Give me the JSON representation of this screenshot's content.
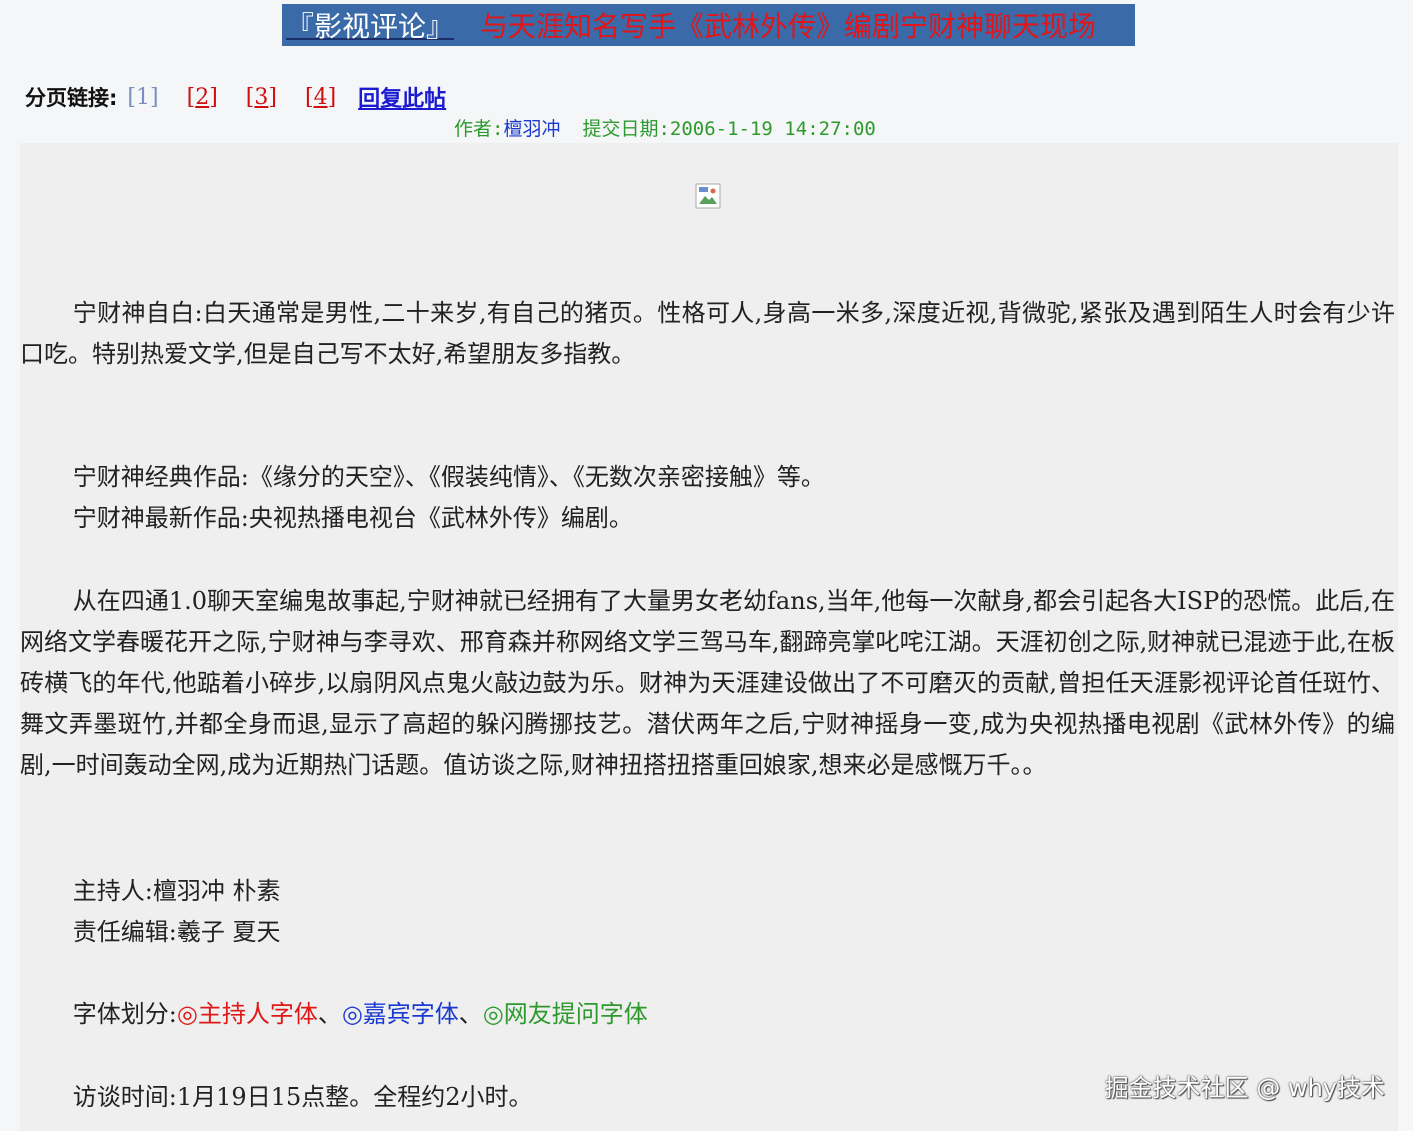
{
  "header": {
    "board": "『影视评论』",
    "title": "与天涯知名写手《武林外传》编剧宁财神聊天现场"
  },
  "paging": {
    "label": "分页链接:",
    "pages": [
      "1",
      "2",
      "3",
      "4"
    ],
    "current": "1",
    "reply": "回复此帖"
  },
  "meta": {
    "author_label": "作者:",
    "author": "檀羽冲",
    "date_label": "提交日期:",
    "date": "2006-1-19 14:27:00"
  },
  "content": {
    "intro": "宁财神自白:白天通常是男性,二十来岁,有自己的猪页。性格可人,身高一米多,深度近视,背微驼,紧张及遇到陌生人时会有少许口吃。特别热爱文学,但是自己写不太好,希望朋友多指教。",
    "classic": "宁财神经典作品:《缘分的天空》、《假装纯情》、《无数次亲密接触》等。",
    "latest": "宁财神最新作品:央视热播电视台《武林外传》编剧。",
    "story": "从在四通1.0聊天室编鬼故事起,宁财神就已经拥有了大量男女老幼fans,当年,他每一次献身,都会引起各大ISP的恐慌。此后,在网络文学春暖花开之际,宁财神与李寻欢、邢育森并称网络文学三驾马车,翻蹄亮掌叱咤江湖。天涯初创之际,财神就已混迹于此,在板砖横飞的年代,他踮着小碎步,以扇阴风点鬼火敲边鼓为乐。财神为天涯建设做出了不可磨灭的贡献,曾担任天涯影视评论首任斑竹、舞文弄墨斑竹,并都全身而退,显示了高超的躲闪腾挪技艺。潜伏两年之后,宁财神摇身一变,成为央视热播电视剧《武林外传》的编剧,一时间轰动全网,成为近期热门话题。值访谈之际,财神扭搭扭搭重回娘家,想来必是感慨万千。。",
    "host": "主持人:檀羽冲 朴素",
    "editor": "责任编辑:羲子 夏天",
    "font_label": "字体划分:",
    "font_host": "◎主持人字体",
    "font_guest": "◎嘉宾字体",
    "font_user": "◎网友提问字体",
    "sep": "、",
    "time": "访谈时间:1月19日15点整。全程约2小时。"
  },
  "watermark": "掘金技术社区 @ why技术",
  "colors": {
    "title_bg": "#3a6aa8",
    "title_red": "#e0161b",
    "host": "#e01818",
    "guest": "#1a3ad0",
    "user": "#2e9a2e"
  }
}
